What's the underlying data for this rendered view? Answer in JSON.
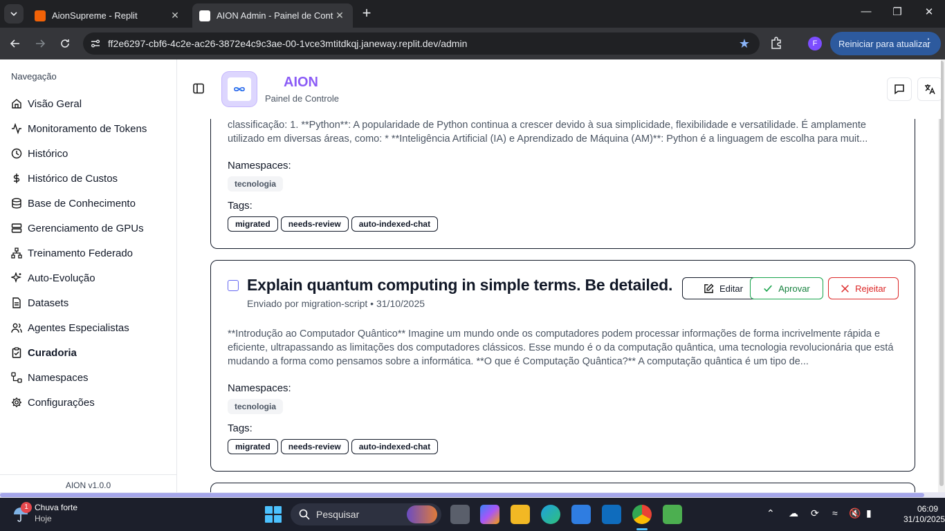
{
  "browser": {
    "tabs": [
      {
        "title": "AionSupreme - Replit",
        "close": "✕"
      },
      {
        "title": "AION Admin - Painel de Controle",
        "close": "✕"
      }
    ],
    "new_tab": "+",
    "url": "ff2e6297-cbf6-4c2e-ac26-3872e4c9c3ae-00-1vce3mtitdkqj.janeway.replit.dev/admin",
    "profile_initial": "F",
    "update_button": "Reiniciar para atualizar",
    "colors": {
      "tabbar": "#202124",
      "toolbar": "#35363a",
      "update": "#2d5a9e"
    }
  },
  "sidebar": {
    "heading": "Navegação",
    "items": [
      {
        "label": "Visão Geral",
        "icon": "home-icon"
      },
      {
        "label": "Monitoramento de Tokens",
        "icon": "activity-icon"
      },
      {
        "label": "Histórico",
        "icon": "clock-icon"
      },
      {
        "label": "Histórico de Custos",
        "icon": "dollar-icon"
      },
      {
        "label": "Base de Conhecimento",
        "icon": "database-icon"
      },
      {
        "label": "Gerenciamento de GPUs",
        "icon": "server-icon"
      },
      {
        "label": "Treinamento Federado",
        "icon": "network-icon"
      },
      {
        "label": "Auto-Evolução",
        "icon": "sparkles-icon"
      },
      {
        "label": "Datasets",
        "icon": "file-icon"
      },
      {
        "label": "Agentes Especialistas",
        "icon": "users-icon"
      },
      {
        "label": "Curadoria",
        "icon": "clipboard-check-icon",
        "active": true
      },
      {
        "label": "Namespaces",
        "icon": "workflow-icon"
      },
      {
        "label": "Configurações",
        "icon": "gear-icon"
      }
    ],
    "footer": "AION v1.0.0"
  },
  "header": {
    "title": "AION",
    "subtitle": "Painel de Controle",
    "logo_text": "AION",
    "accent": "#8b5cf6"
  },
  "curation": {
    "items": [
      {
        "excerpt": [
          "classificação: 1. **Python**: A popularidade de Python continua a crescer devido à sua simplicidade, flexibilidade e versatilidade. É amplamente",
          "utilizado em diversas áreas, como: * **Inteligência Artificial (IA) e Aprendizado de Máquina (AM)**: Python é a linguagem de escolha para muit..."
        ],
        "namespaces_label": "Namespaces:",
        "namespaces": [
          "tecnologia"
        ],
        "tags_label": "Tags:",
        "tags": [
          "migrated",
          "needs-review",
          "auto-indexed-chat"
        ]
      },
      {
        "title": "Explain quantum computing in simple terms. Be detailed.",
        "meta": "Enviado por migration-script • 31/10/2025",
        "actions": {
          "edit": "Editar",
          "approve": "Aprovar",
          "reject": "Rejeitar"
        },
        "excerpt": "**Introdução ao Computador Quântico** Imagine um mundo onde os computadores podem processar informações de forma incrivelmente rápida e eficiente, ultrapassando as limitações dos computadores clássicos. Esse mundo é o da computação quântica, uma tecnologia revolucionária que está mudando a forma como pensamos sobre a informática. **O que é Computação Quântica?** A computação quântica é um tipo de...",
        "namespaces_label": "Namespaces:",
        "namespaces": [
          "tecnologia"
        ],
        "tags_label": "Tags:",
        "tags": [
          "migrated",
          "needs-review",
          "auto-indexed-chat"
        ]
      }
    ]
  },
  "taskbar": {
    "weather_title": "Chuva forte",
    "weather_sub": "Hoje",
    "weather_badge": "1",
    "search": "Pesquisar",
    "time": "06:09",
    "date": "31/10/2025"
  }
}
